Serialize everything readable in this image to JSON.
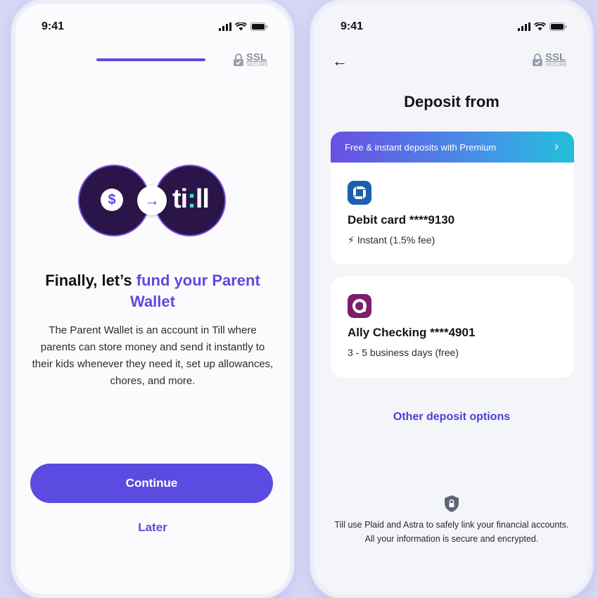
{
  "left_screen": {
    "status_time": "9:41",
    "ssl_label": "SSL",
    "ssl_sublabel": "SECURE",
    "onboarding_progress": 1.0,
    "logo_text_main": "ti",
    "logo_text_dot": ":",
    "logo_text_end": "ll",
    "dollar_symbol": "$",
    "headline_prefix": "Finally, let’s ",
    "headline_accent": "fund your Parent Wallet",
    "description": "The Parent Wallet is an account in Till where parents can store money and send it instantly to their kids whenever they need it, set up allowances, chores, and more.",
    "continue_label": "Continue",
    "later_label": "Later"
  },
  "right_screen": {
    "status_time": "9:41",
    "ssl_label": "SSL",
    "ssl_sublabel": "SECURE",
    "title": "Deposit from",
    "promo_text": "Free & instant deposits with Premium",
    "accounts": [
      {
        "name": "Debit card ****9130",
        "detail": "Instant (1.5% fee)",
        "icon": "chase-bank-icon"
      },
      {
        "name": "Ally Checking ****4901",
        "detail": "3 - 5 business days (free)",
        "icon": "ally-bank-icon"
      }
    ],
    "other_options_label": "Other deposit options",
    "disclaimer": "Till use Plaid and Astra to safely link your financial accounts. All your information is secure and encrypted."
  },
  "colors": {
    "accent": "#5b4be0",
    "background": "#d7d6f5",
    "promo_gradient_start": "#6a4fe4",
    "promo_gradient_end": "#22c0d8",
    "chase_blue": "#1b5fae",
    "ally_purple": "#7b1f6c"
  }
}
